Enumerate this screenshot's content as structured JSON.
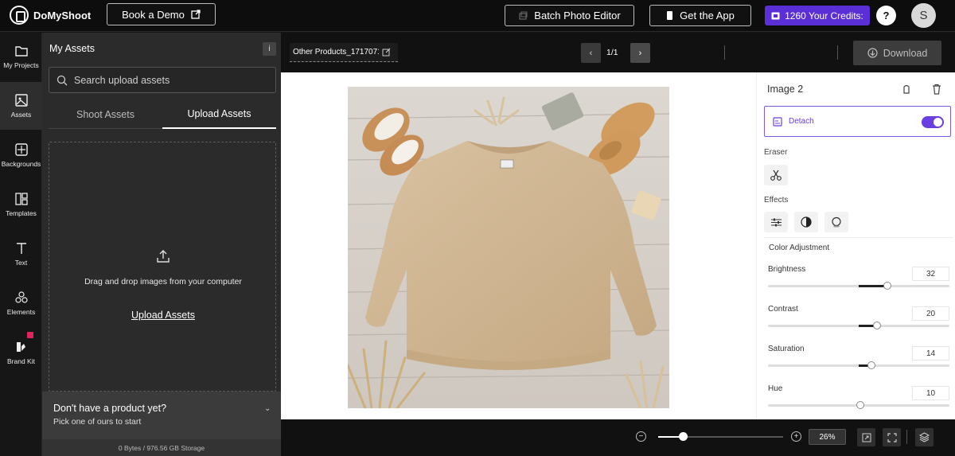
{
  "app": {
    "name": "DoMyShoot"
  },
  "header": {
    "book_demo": "Book a Demo",
    "batch_editor": "Batch Photo Editor",
    "get_app": "Get the App",
    "credits": "1260 Your Credits:",
    "help": "?",
    "avatar_initial": "S",
    "accent_color": "#5b2fd6"
  },
  "rail": {
    "items": [
      {
        "label": "My Projects",
        "icon": "folder-icon"
      },
      {
        "label": "Assets",
        "icon": "image-icon"
      },
      {
        "label": "Backgrounds",
        "icon": "backgrounds-icon"
      },
      {
        "label": "Templates",
        "icon": "templates-icon"
      },
      {
        "label": "Text",
        "icon": "text-icon"
      },
      {
        "label": "Elements",
        "icon": "shapes-icon"
      },
      {
        "label": "Brand Kit",
        "icon": "brand-kit-icon"
      }
    ]
  },
  "assets": {
    "title": "My Assets",
    "search_placeholder": "Search upload assets",
    "tabs": [
      "Shoot Assets",
      "Upload Assets"
    ],
    "drop_text": "Drag and drop images from your computer",
    "upload_link": "Upload Assets",
    "promo_title": "Don't have a product yet?",
    "promo_sub": "Pick one of ours to start",
    "storage": "0 Bytes / 976.56 GB Storage"
  },
  "canvas": {
    "filename": "Other Products_1717071",
    "page": "1/1",
    "download": "Download"
  },
  "props": {
    "layer_title": "Image 2",
    "detach_label": "Detach",
    "detach_on": true,
    "eraser_label": "Eraser",
    "effects_label": "Effects",
    "color_adjustment": "Color Adjustment",
    "adjustments": [
      {
        "label": "Brightness",
        "value": "32",
        "level": 0.66
      },
      {
        "label": "Contrast",
        "value": "20",
        "level": 0.6
      },
      {
        "label": "Saturation",
        "value": "14",
        "level": 0.57
      },
      {
        "label": "Hue",
        "value": "10",
        "level": 0.51
      }
    ]
  },
  "footer": {
    "zoom": "26%",
    "zoom_level": 0.2
  }
}
